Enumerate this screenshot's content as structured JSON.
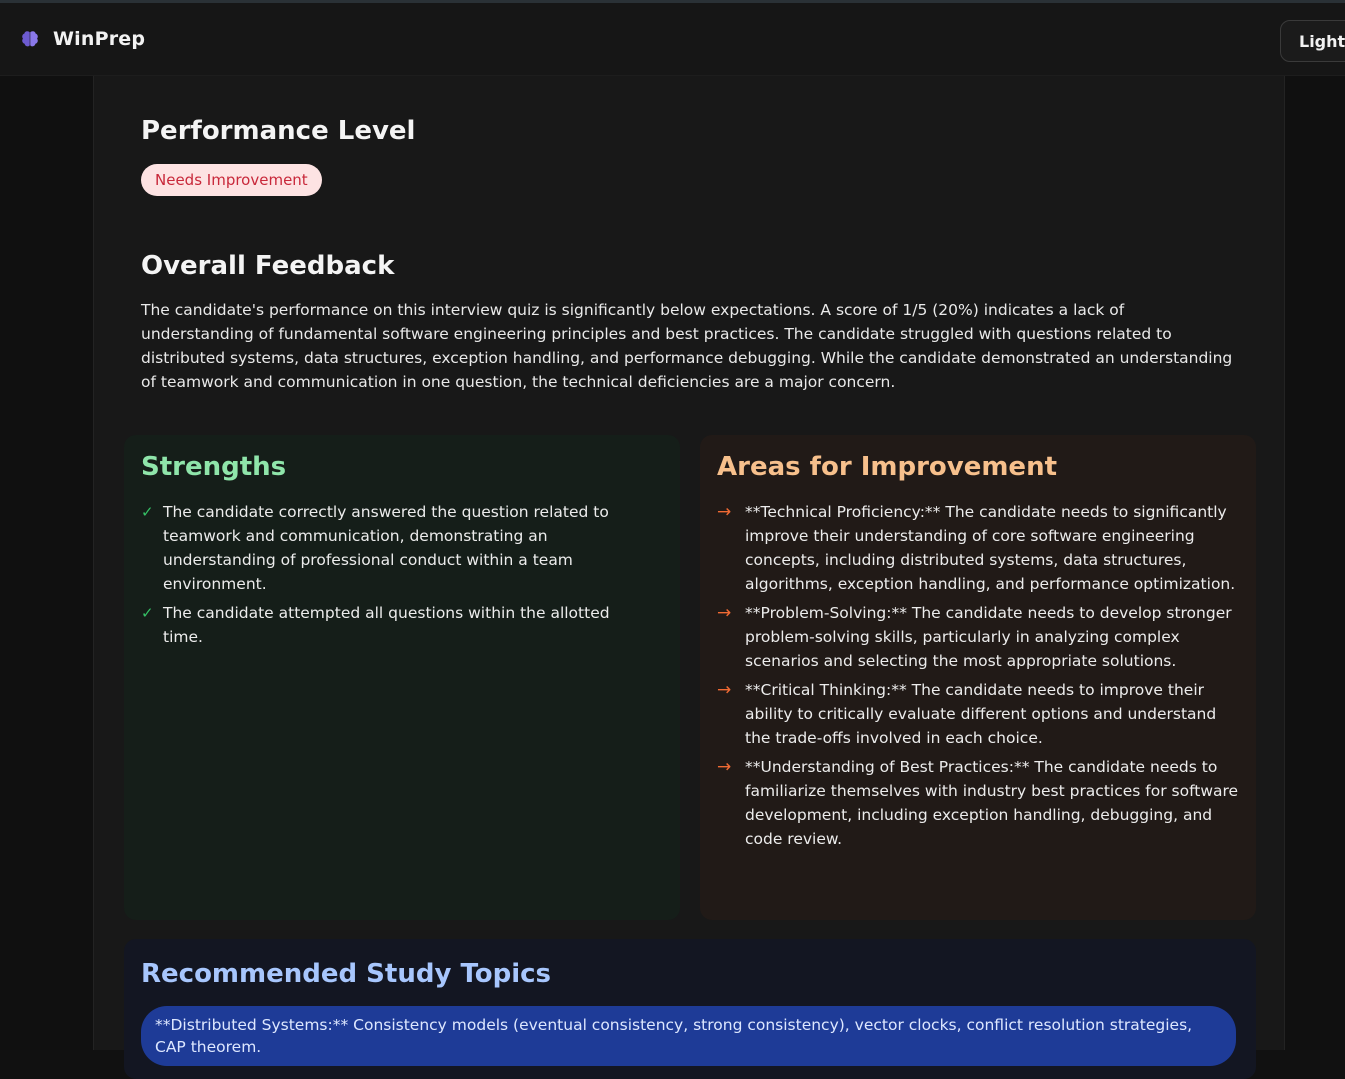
{
  "app": {
    "name": "WinPrep",
    "theme_toggle_label": "Light",
    "accent_color": "#6d5bd0"
  },
  "performance": {
    "title": "Performance Level",
    "badge": "Needs Improvement"
  },
  "feedback": {
    "title": "Overall Feedback",
    "text": "The candidate's performance on this interview quiz is significantly below expectations. A score of 1/5 (20%) indicates a lack of understanding of fundamental software engineering principles and best practices. The candidate struggled with questions related to distributed systems, data structures, exception handling, and performance debugging. While the candidate demonstrated an understanding of teamwork and communication in one question, the technical deficiencies are a major concern."
  },
  "strengths": {
    "title": "Strengths",
    "icon": "check-icon",
    "mark": "✓",
    "items": [
      "The candidate correctly answered the question related to teamwork and communication, demonstrating an understanding of professional conduct within a team environment.",
      "The candidate attempted all questions within the allotted time."
    ]
  },
  "improvements": {
    "title": "Areas for Improvement",
    "icon": "arrow-right-icon",
    "mark": "→",
    "items": [
      "**Technical Proficiency:** The candidate needs to significantly improve their understanding of core software engineering concepts, including distributed systems, data structures, algorithms, exception handling, and performance optimization.",
      "**Problem-Solving:** The candidate needs to develop stronger problem-solving skills, particularly in analyzing complex scenarios and selecting the most appropriate solutions.",
      "**Critical Thinking:** The candidate needs to improve their ability to critically evaluate different options and understand the trade-offs involved in each choice.",
      "**Understanding of Best Practices:** The candidate needs to familiarize themselves with industry best practices for software development, including exception handling, debugging, and code review."
    ]
  },
  "study": {
    "title": "Recommended Study Topics",
    "topics": [
      "**Distributed Systems:** Consistency models (eventual consistency, strong consistency), vector clocks, conflict resolution strategies, CAP theorem."
    ]
  }
}
